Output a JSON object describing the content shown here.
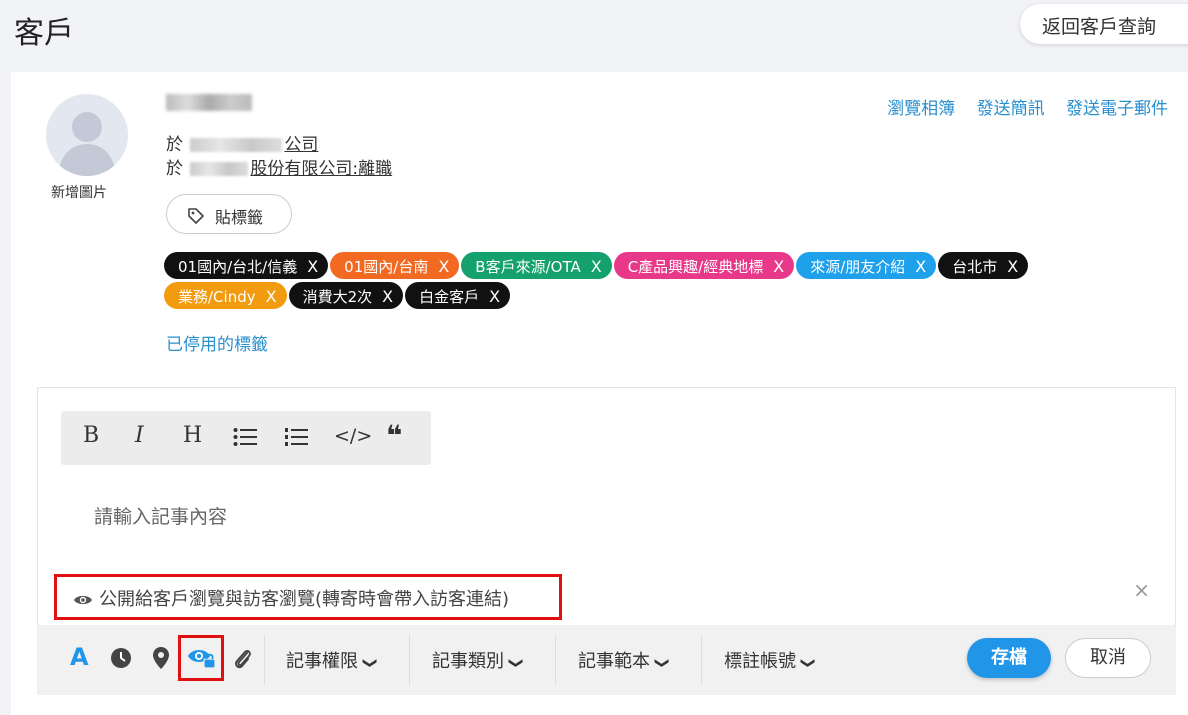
{
  "header": {
    "title": "客戶",
    "back_label": "返回客戶查詢"
  },
  "profile": {
    "avatar_caption": "新增圖片",
    "company_prefix": "於",
    "company_line1_suffix": "公司",
    "company_line2_suffix": "股份有限公司:離職"
  },
  "links": {
    "album": "瀏覽相簿",
    "sms": "發送簡訊",
    "email": "發送電子郵件"
  },
  "tag_button": {
    "label": "貼標籤"
  },
  "tags": [
    {
      "label": "01國內/台北/信義",
      "color": "#111111"
    },
    {
      "label": "01國內/台南",
      "color": "#f26a22"
    },
    {
      "label": "B客戶來源/OTA",
      "color": "#14a16e"
    },
    {
      "label": "C產品興趣/經典地標",
      "color": "#e8388a"
    },
    {
      "label": "來源/朋友介紹",
      "color": "#1fa0ea"
    },
    {
      "label": "台北市",
      "color": "#111111"
    },
    {
      "label": "業務/Cindy",
      "color": "#f29b0f"
    },
    {
      "label": "消費大2次",
      "color": "#111111"
    },
    {
      "label": "白金客戶",
      "color": "#111111"
    }
  ],
  "tag_remove": "X",
  "disabled_tags_link": "已停用的標籤",
  "editor": {
    "toolbar": {
      "bold": "B",
      "italic": "I",
      "heading": "H",
      "code": "</>",
      "quote": "❝"
    },
    "placeholder": "請輸入記事內容",
    "public_notice": "公開給客戶瀏覽與訪客瀏覽(轉寄時會帶入訪客連結)",
    "close": "×"
  },
  "bottom": {
    "text_color_icon": "A",
    "permission": "記事權限",
    "category": "記事類別",
    "template": "記事範本",
    "mark_account": "標註帳號",
    "chevron": "❯",
    "save": "存檔",
    "cancel": "取消"
  },
  "colors": {
    "accent": "#2196e8",
    "highlight": "#e01010"
  }
}
